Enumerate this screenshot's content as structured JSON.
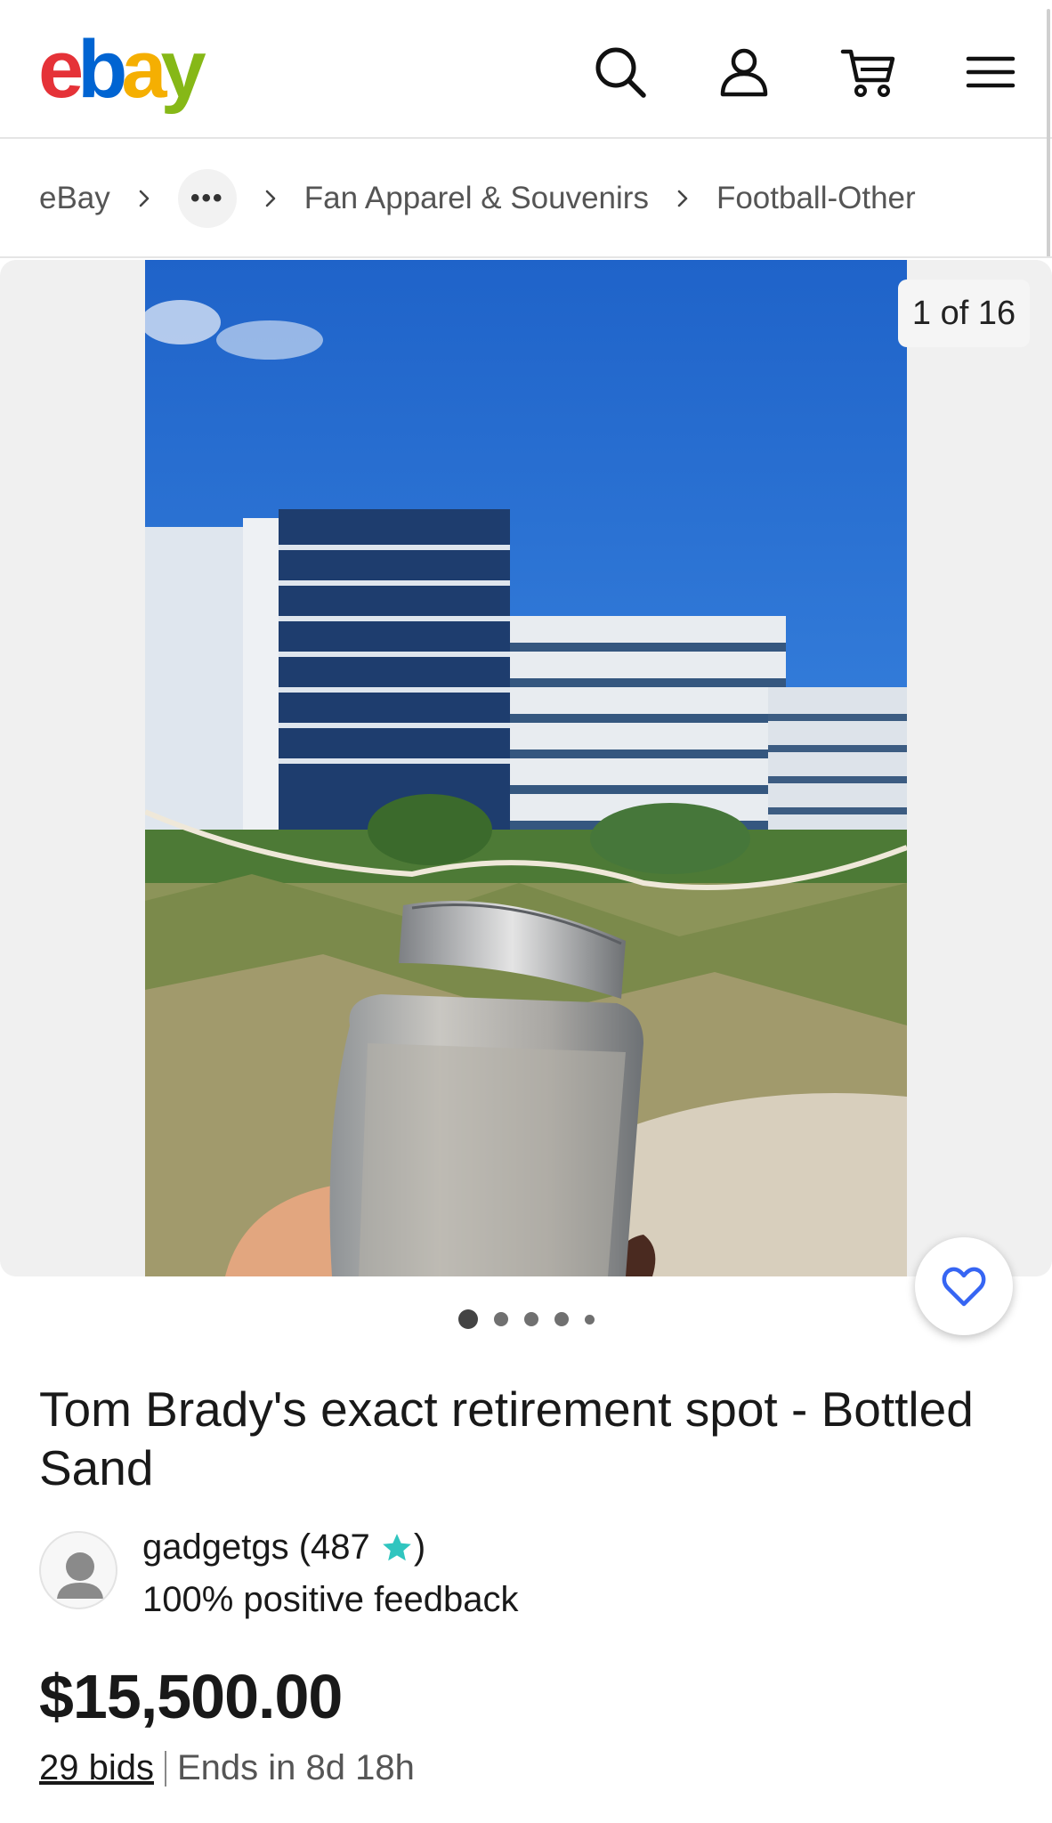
{
  "header": {
    "logo_letters": [
      "e",
      "b",
      "a",
      "y"
    ],
    "logo_colors": [
      "#e53238",
      "#0064d2",
      "#f5af02",
      "#86b817"
    ],
    "icons": [
      "search-icon",
      "user-icon",
      "cart-icon",
      "menu-icon"
    ]
  },
  "breadcrumb": {
    "items": [
      "eBay",
      "•••",
      "Fan Apparel & Souvenirs",
      "Football-Other"
    ]
  },
  "gallery": {
    "counter": "1 of 16",
    "dot_count": 5,
    "active_dot": 0
  },
  "listing": {
    "title": "Tom Brady's exact retirement spot - Bottled Sand",
    "seller": {
      "name_prefix": "gadgetgs (487 ",
      "name_suffix": ")",
      "star_color": "#30c5bf",
      "feedback": "100% positive feedback"
    },
    "price": "$15,500.00",
    "bids": "29 bids",
    "ends": "Ends in 8d 18h"
  },
  "colors": {
    "text_primary": "#191919",
    "text_secondary": "#555555",
    "watch_heart": "#3665f3"
  }
}
